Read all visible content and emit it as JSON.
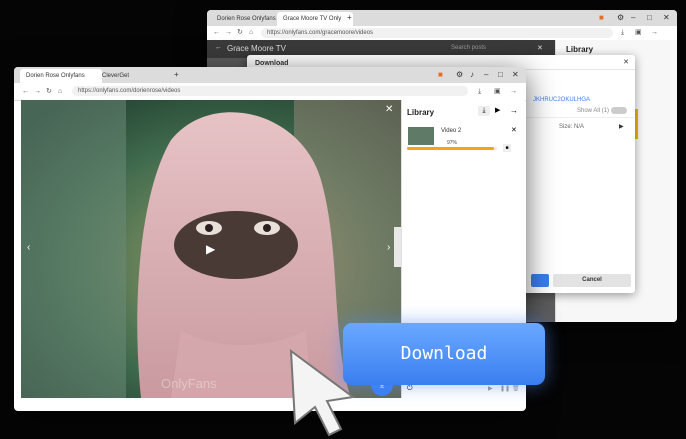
{
  "back_window": {
    "tabs": [
      "Dorien Rose Onlyfans",
      "Grace Moore TV Only"
    ],
    "url": "https://onlyfans.com/gracemoore/videos",
    "page_title": "Grace Moore TV",
    "search_placeholder": "Search posts",
    "library_title": "Library",
    "dialog": {
      "title": "Download",
      "id_fragment": "JKHRUC2OKULHGA",
      "show_all_label": "Show All (1)",
      "size_label": "Size: N/A",
      "cancel_label": "Cancel"
    }
  },
  "front_window": {
    "tabs": [
      "Dorien Rose Onlyfans",
      "CleverGet"
    ],
    "url": "https://onlyfans.com/dorienrose/videos",
    "library_title": "Library",
    "item": {
      "title": "Video 2",
      "progress_label": "97%",
      "progress": 0.97
    },
    "watermark": "OnlyFans"
  },
  "cta": {
    "label": "Download",
    "color": "#3a7ff0"
  }
}
